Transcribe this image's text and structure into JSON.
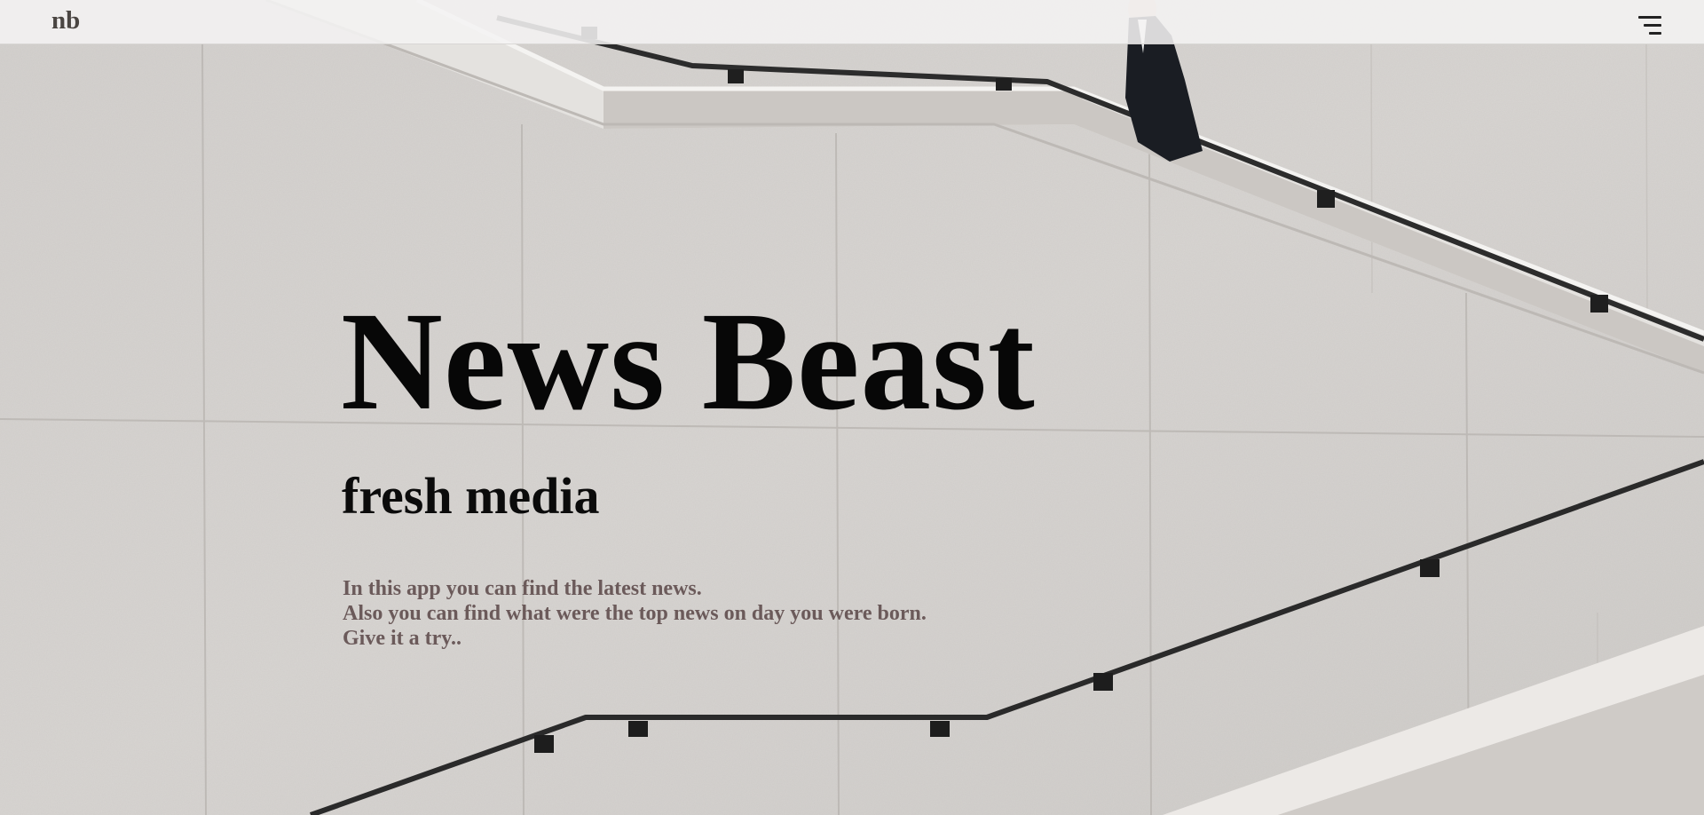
{
  "header": {
    "logo_text": "nb",
    "menu_icon": "hamburger-menu-icon"
  },
  "hero": {
    "title": "News Beast",
    "subtitle": "fresh media",
    "description_lines": [
      "In this app you can find the latest news.",
      "Also you can find what were the top news on day you were born.",
      "Give it a try.."
    ],
    "background_image": "concrete-staircase-with-handrails-and-man-in-suit"
  },
  "colors": {
    "header_bg": "#f4f3f2",
    "title": "#070707",
    "description": "#6b5a5a",
    "concrete": "#d6d3d0"
  }
}
